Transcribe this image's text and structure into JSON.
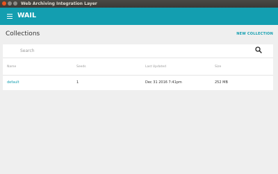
{
  "window": {
    "title": "Web Archiving Integration Layer"
  },
  "appbar": {
    "title": "WAIL"
  },
  "collections": {
    "title": "Collections",
    "new_button": "NEW COLLECTION",
    "search_placeholder": "Search",
    "columns": [
      "Name",
      "Seeds",
      "Last Updated",
      "Size"
    ],
    "rows": [
      {
        "name": "default",
        "seeds": "1",
        "last_updated": "Dec 31 2016 7:41pm",
        "size": "252 MB"
      }
    ]
  },
  "colors": {
    "accent": "#139eb0",
    "titlebar": "#3b3a36",
    "background": "#efefef",
    "close_button": "#e9541f"
  },
  "icons": [
    "menu-icon",
    "search-icon"
  ]
}
